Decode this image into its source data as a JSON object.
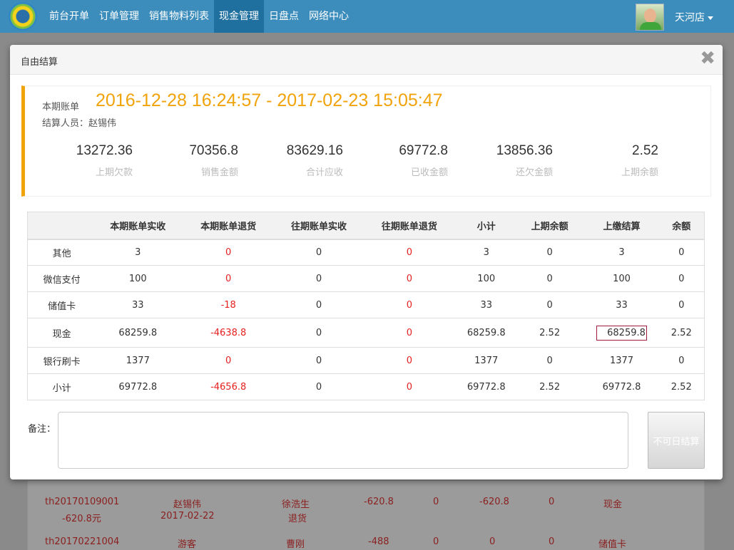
{
  "navbar": {
    "menu": [
      "前台开单",
      "订单管理",
      "销售物料列表",
      "现金管理",
      "日盘点",
      "网络中心"
    ],
    "active_index": 3,
    "store": "天河店"
  },
  "background_rows": [
    {
      "cells": [
        "th20170109001",
        "赵锡伟",
        "徐浩生",
        "-620.8",
        "0",
        "-620.8",
        "0",
        "现金"
      ],
      "sub": [
        "-620.8元",
        "2017-02-22",
        "退货"
      ]
    },
    {
      "cells": [
        "th20170221004",
        "游客",
        "曹刚",
        "-488",
        "0",
        "0",
        "0",
        "储值卡"
      ]
    }
  ],
  "modal": {
    "title": "自由结算",
    "close": "✖",
    "period_label": "本期账单",
    "period_value": "2016-12-28 16:24:57 - 2017-02-23 15:05:47",
    "operator_label": "结算人员：",
    "operator_name": "赵锡伟",
    "stats": [
      {
        "value": "13272.36",
        "label": "上期欠款"
      },
      {
        "value": "70356.8",
        "label": "销售金额"
      },
      {
        "value": "83629.16",
        "label": "合计应收"
      },
      {
        "value": "69772.8",
        "label": "已收金额"
      },
      {
        "value": "13856.36",
        "label": "还欠金额"
      },
      {
        "value": "2.52",
        "label": "上期余额"
      }
    ],
    "table": {
      "headers": [
        "",
        "本期账单实收",
        "本期账单退货",
        "往期账单实收",
        "往期账单退货",
        "小计",
        "上期余额",
        "上缴结算",
        "余额"
      ],
      "rows": [
        [
          "其他",
          "3",
          "0",
          "0",
          "0",
          "3",
          "0",
          "3",
          "0"
        ],
        [
          "微信支付",
          "100",
          "0",
          "0",
          "0",
          "100",
          "0",
          "100",
          "0"
        ],
        [
          "储值卡",
          "33",
          "-18",
          "0",
          "0",
          "33",
          "0",
          "33",
          "0"
        ],
        [
          "现金",
          "68259.8",
          "-4638.8",
          "0",
          "0",
          "68259.8",
          "2.52",
          "68259.8",
          "2.52"
        ],
        [
          "银行刷卡",
          "1377",
          "0",
          "0",
          "0",
          "1377",
          "0",
          "1377",
          "0"
        ],
        [
          "小计",
          "69772.8",
          "-4656.8",
          "0",
          "0",
          "69772.8",
          "2.52",
          "69772.8",
          "2.52"
        ]
      ]
    },
    "remark_label": "备注：",
    "remark_value": "",
    "settle_button": "不可日结算"
  }
}
